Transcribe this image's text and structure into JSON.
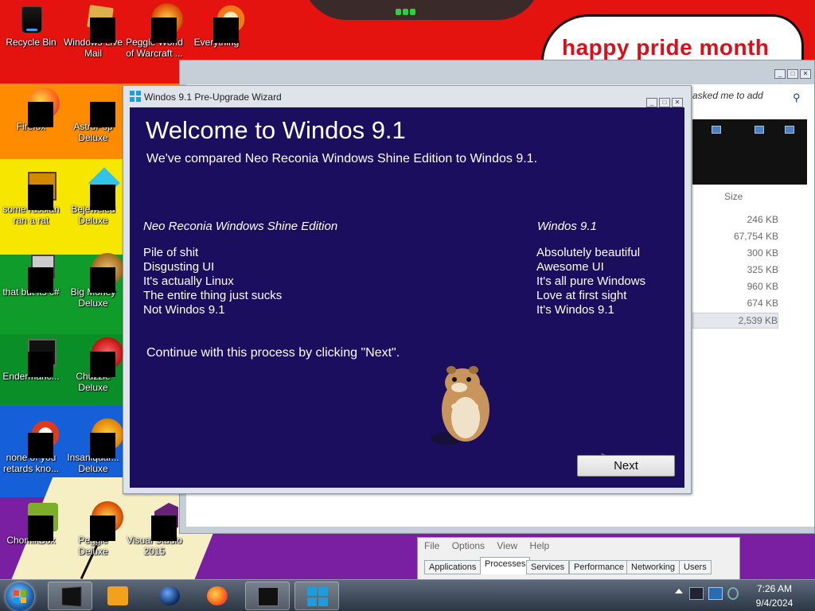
{
  "wallpaper": {
    "caption": "happy pride month"
  },
  "desktop_icons": [
    {
      "label": "Recycle Bin"
    },
    {
      "label": "Windows Live Mail"
    },
    {
      "label": "Peggle World of Warcraft ..."
    },
    {
      "label": "Everything"
    },
    {
      "label": "Firefox"
    },
    {
      "label": "AstroPop Deluxe"
    },
    {
      "label": "some russian ran a rat"
    },
    {
      "label": "Bejeweled Deluxe"
    },
    {
      "label": "that but its c#"
    },
    {
      "label": "Big Money Deluxe"
    },
    {
      "label": "Endermanc..."
    },
    {
      "label": "Chuzzle Deluxe"
    },
    {
      "label": "none of you retards kno..."
    },
    {
      "label": "Insaniquar... Deluxe"
    },
    {
      "label": "ChomikBox"
    },
    {
      "label": "Peggle Deluxe"
    },
    {
      "label": "Visual Studio 2015"
    }
  ],
  "explorer": {
    "search_placeholder": "e asked me to add",
    "size_header": "Size",
    "sizes": [
      "246 KB",
      "67,754 KB",
      "300 KB",
      "325 KB",
      "960 KB",
      "674 KB",
      "2,539 KB"
    ]
  },
  "wizard": {
    "window_title": "Windos 9.1 Pre-Upgrade Wizard",
    "heading": "Welcome to Windos 9.1",
    "subheading": "We've compared Neo Reconia Windows Shine Edition  to Windos 9.1.",
    "left_column": {
      "header": "Neo Reconia Windows Shine Edition",
      "items": [
        "Pile of shit",
        "Disgusting UI",
        "It's actually Linux",
        "The entire thing just sucks",
        "Not Windos 9.1"
      ]
    },
    "right_column": {
      "header": "Windos 9.1",
      "items": [
        "Absolutely beautiful",
        "Awesome UI",
        "It's all pure Windows",
        "Love at first sight",
        "It's Windos 9.1"
      ]
    },
    "continue_text": "Continue with this process by clicking \"Next\".",
    "next_label": "Next"
  },
  "task_manager": {
    "menu": [
      "File",
      "Options",
      "View",
      "Help"
    ],
    "tabs": [
      "Applications",
      "Processes",
      "Services",
      "Performance",
      "Networking",
      "Users"
    ],
    "active_tab": "Processes"
  },
  "taskbar": {
    "pinned": [
      "window-icon",
      "media-player-icon",
      "globe-icon",
      "firefox-icon",
      "terminal-icon",
      "windows-logo-icon"
    ],
    "clock_time": "7:26 AM",
    "clock_date": "9/4/2024"
  },
  "colors": {
    "wizard_bg": "#1c0e5e",
    "caption_red": "#d8101a"
  }
}
